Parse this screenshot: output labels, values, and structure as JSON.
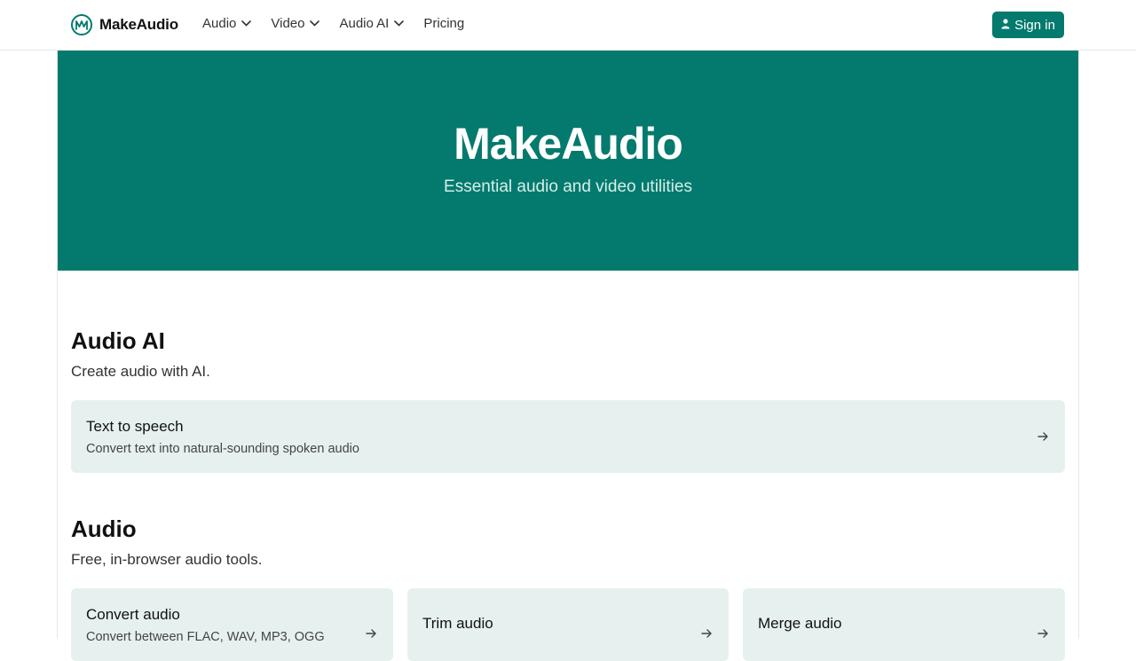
{
  "brand": {
    "name": "MakeAudio",
    "logo_icon": "makeaudio-logo-icon"
  },
  "nav": [
    {
      "label": "Audio",
      "has_dropdown": true
    },
    {
      "label": "Video",
      "has_dropdown": true
    },
    {
      "label": "Audio AI",
      "has_dropdown": true
    },
    {
      "label": "Pricing",
      "has_dropdown": false
    }
  ],
  "signin": {
    "label": "Sign in",
    "icon": "user-icon"
  },
  "hero": {
    "title": "MakeAudio",
    "subtitle": "Essential audio and video utilities"
  },
  "sections": {
    "audio_ai": {
      "title": "Audio AI",
      "subtitle": "Create audio with AI.",
      "cards": [
        {
          "title": "Text to speech",
          "desc": "Convert text into natural-sounding spoken audio"
        }
      ]
    },
    "audio": {
      "title": "Audio",
      "subtitle": "Free, in-browser audio tools.",
      "cards": [
        {
          "title": "Convert audio",
          "desc": "Convert between FLAC, WAV, MP3, OGG"
        },
        {
          "title": "Trim audio",
          "desc": ""
        },
        {
          "title": "Merge audio",
          "desc": ""
        }
      ]
    }
  },
  "colors": {
    "accent": "#037a6d",
    "card_bg": "#e6f1ef",
    "hero_subtitle": "#d6eeea"
  }
}
